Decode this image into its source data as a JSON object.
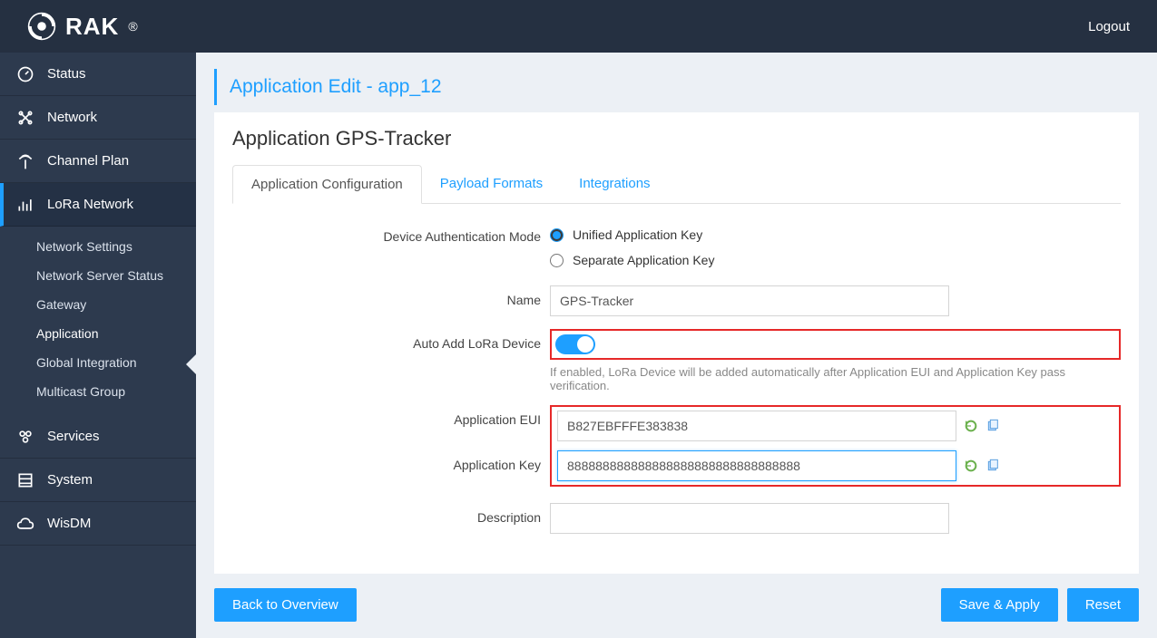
{
  "header": {
    "brand": "RAK",
    "logout": "Logout"
  },
  "sidebar": {
    "items": [
      {
        "label": "Status"
      },
      {
        "label": "Network"
      },
      {
        "label": "Channel Plan"
      },
      {
        "label": "LoRa Network"
      },
      {
        "label": "Services"
      },
      {
        "label": "System"
      },
      {
        "label": "WisDM"
      }
    ],
    "sub": [
      {
        "label": "Network Settings"
      },
      {
        "label": "Network Server Status"
      },
      {
        "label": "Gateway"
      },
      {
        "label": "Application"
      },
      {
        "label": "Global Integration"
      },
      {
        "label": "Multicast Group"
      }
    ]
  },
  "page": {
    "title": "Application Edit - app_12",
    "panel_title": "Application GPS-Tracker"
  },
  "tabs": [
    {
      "label": "Application Configuration"
    },
    {
      "label": "Payload Formats"
    },
    {
      "label": "Integrations"
    }
  ],
  "form": {
    "auth_mode_label": "Device Authentication Mode",
    "auth_unified": "Unified Application Key",
    "auth_separate": "Separate Application Key",
    "name_label": "Name",
    "name_value": "GPS-Tracker",
    "auto_add_label": "Auto Add LoRa Device",
    "auto_add_hint": "If enabled, LoRa Device will be added automatically after Application EUI and Application Key pass verification.",
    "eui_label": "Application EUI",
    "eui_value": "B827EBFFFE383838",
    "key_label": "Application Key",
    "key_value": "888888888888888888888888888888888",
    "desc_label": "Description"
  },
  "buttons": {
    "back": "Back to Overview",
    "save": "Save & Apply",
    "reset": "Reset"
  }
}
